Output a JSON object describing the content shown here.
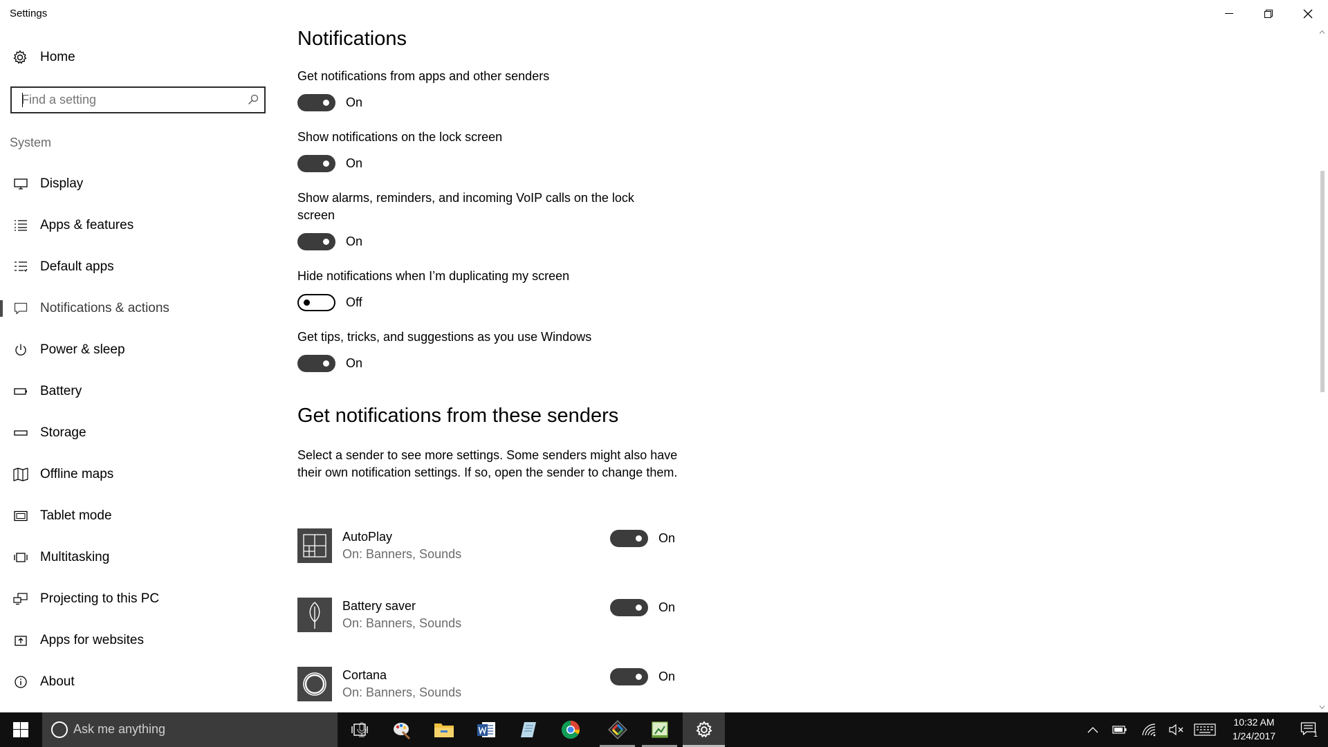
{
  "window": {
    "title": "Settings",
    "controls": [
      "minimize",
      "restore",
      "close"
    ]
  },
  "sidebar": {
    "home_label": "Home",
    "search": {
      "placeholder": "Find a setting",
      "value": ""
    },
    "section_label": "System",
    "items": [
      {
        "label": "Display",
        "icon": "display-icon",
        "selected": false
      },
      {
        "label": "Apps & features",
        "icon": "apps-list-icon",
        "selected": false
      },
      {
        "label": "Default apps",
        "icon": "default-apps-icon",
        "selected": false
      },
      {
        "label": "Notifications & actions",
        "icon": "notification-icon",
        "selected": true
      },
      {
        "label": "Power & sleep",
        "icon": "power-icon",
        "selected": false
      },
      {
        "label": "Battery",
        "icon": "battery-icon",
        "selected": false
      },
      {
        "label": "Storage",
        "icon": "storage-icon",
        "selected": false
      },
      {
        "label": "Offline maps",
        "icon": "map-icon",
        "selected": false
      },
      {
        "label": "Tablet mode",
        "icon": "tablet-icon",
        "selected": false
      },
      {
        "label": "Multitasking",
        "icon": "multitasking-icon",
        "selected": false
      },
      {
        "label": "Projecting to this PC",
        "icon": "projecting-icon",
        "selected": false
      },
      {
        "label": "Apps for websites",
        "icon": "apps-websites-icon",
        "selected": false
      },
      {
        "label": "About",
        "icon": "info-icon",
        "selected": false
      }
    ]
  },
  "main": {
    "heading": "Notifications",
    "settings": [
      {
        "label": "Get notifications from apps and other senders",
        "state": "On",
        "on": true
      },
      {
        "label": "Show notifications on the lock screen",
        "state": "On",
        "on": true
      },
      {
        "label": "Show alarms, reminders, and incoming VoIP calls on the lock screen",
        "state": "On",
        "on": true
      },
      {
        "label": "Hide notifications when I’m duplicating my screen",
        "state": "Off",
        "on": false
      },
      {
        "label": "Get tips, tricks, and suggestions as you use Windows",
        "state": "On",
        "on": true
      }
    ],
    "senders_heading": "Get notifications from these senders",
    "senders_description": "Select a sender to see more settings. Some senders might also have their own notification settings. If so, open the sender to change them.",
    "senders": [
      {
        "name": "AutoPlay",
        "detail": "On: Banners, Sounds",
        "state": "On",
        "on": true,
        "icon": "autoplay-icon"
      },
      {
        "name": "Battery saver",
        "detail": "On: Banners, Sounds",
        "state": "On",
        "on": true,
        "icon": "battery-saver-icon"
      },
      {
        "name": "Cortana",
        "detail": "On: Banners, Sounds",
        "state": "On",
        "on": true,
        "icon": "cortana-icon"
      }
    ]
  },
  "taskbar": {
    "search_placeholder": "Ask me anything",
    "apps": [
      {
        "name": "task-view",
        "running": false,
        "active": false
      },
      {
        "name": "paint",
        "running": false,
        "active": false
      },
      {
        "name": "file-explorer",
        "running": false,
        "active": false
      },
      {
        "name": "word",
        "running": false,
        "active": false
      },
      {
        "name": "notes",
        "running": false,
        "active": false
      },
      {
        "name": "chrome",
        "running": false,
        "active": false
      },
      {
        "name": "snipping",
        "running": true,
        "active": false
      },
      {
        "name": "sheet-app",
        "running": true,
        "active": false
      },
      {
        "name": "settings",
        "running": true,
        "active": true
      }
    ],
    "clock": {
      "time": "10:32 AM",
      "date": "1/24/2017"
    },
    "notification_count": "1"
  }
}
